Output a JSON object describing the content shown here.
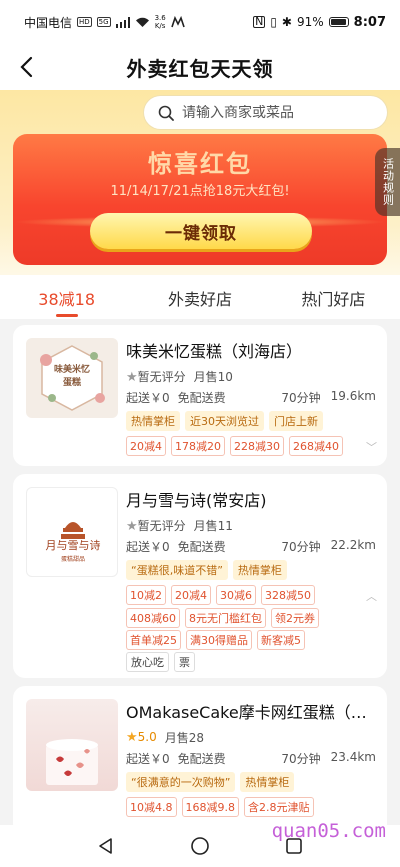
{
  "status": {
    "carrier": "中国电信",
    "hd": "HD",
    "net": "5G",
    "speed": "3.6",
    "speed_unit": "K/s",
    "battery": "91%",
    "time": "8:07"
  },
  "nav": {
    "title": "外卖红包天天领",
    "back_icon": "back-chevron-icon"
  },
  "search": {
    "placeholder": "请输入商家或菜品",
    "icon": "search-icon"
  },
  "banner": {
    "title": "惊喜红包",
    "subtitle": "11/14/17/21点抢18元大红包!",
    "cta": "一键领取",
    "rules_label": "活动规则"
  },
  "tabs": [
    {
      "label": "38减18",
      "active": true
    },
    {
      "label": "外卖好店",
      "active": false
    },
    {
      "label": "热门好店",
      "active": false
    }
  ],
  "shops": [
    {
      "name": "味美米忆蛋糕（刘海店）",
      "rating": "暂无评分",
      "monthly_sales": "月售10",
      "min_order": "起送￥0",
      "delivery_fee": "免配送费",
      "time": "70分钟",
      "distance": "19.6km",
      "labels": [
        "热情掌柜",
        "近30天浏览过",
        "门店上新"
      ],
      "discounts": [
        "20减4",
        "178减20",
        "228减30",
        "268减40"
      ],
      "thumb_text_1": "味美米忆",
      "thumb_text_2": "蛋糕"
    },
    {
      "name": "月与雪与诗(常安店)",
      "rating": "暂无评分",
      "monthly_sales": "月售11",
      "min_order": "起送￥0",
      "delivery_fee": "免配送费",
      "time": "70分钟",
      "distance": "22.2km",
      "labels": [
        "“蛋糕很,味道不错”",
        "热情掌柜"
      ],
      "discounts_row1": [
        "10减2",
        "20减4",
        "30减6",
        "328减50"
      ],
      "discounts_row2": [
        "408减60",
        "8元无门槛红包",
        "领2元券"
      ],
      "discounts_row3": [
        "首单减25",
        "满30得赠品",
        "新客减5"
      ],
      "extra": [
        "放心吃",
        "票"
      ],
      "thumb_text_1": "月与雪与诗",
      "thumb_text_2": "蛋糕甜品"
    },
    {
      "name": "OMakaseCake摩卡网红蛋糕（…",
      "rating": "5.0",
      "monthly_sales": "月售28",
      "min_order": "起送￥0",
      "delivery_fee": "免配送费",
      "time": "70分钟",
      "distance": "23.4km",
      "labels": [
        "“很满意的一次购物”",
        "热情掌柜"
      ],
      "discounts": [
        "10减4.8",
        "168减9.8",
        "含2.8元津贴"
      ]
    }
  ],
  "watermark": "quan05.com"
}
